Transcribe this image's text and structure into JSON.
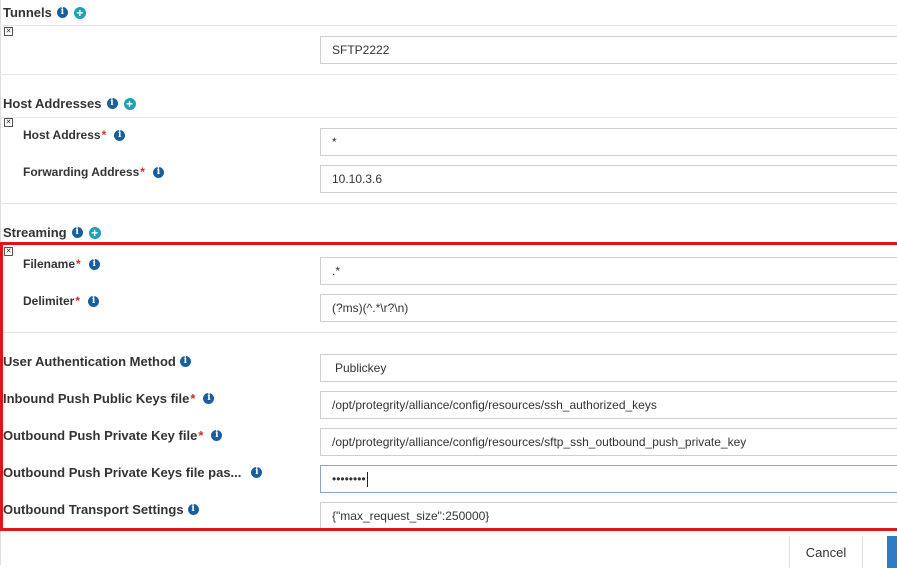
{
  "tunnels": {
    "title": "Tunnels",
    "info_icon": "i",
    "add_icon": "+",
    "remove_icon": "✕",
    "value": "SFTP2222"
  },
  "host_addresses": {
    "title": "Host Addresses",
    "info_icon": "i",
    "add_icon": "+",
    "remove_icon": "✕",
    "host_address": {
      "label": "Host Address",
      "required_mark": "*",
      "value": "*"
    },
    "forwarding_address": {
      "label": "Forwarding Address",
      "required_mark": "*",
      "value": "10.10.3.6"
    }
  },
  "streaming": {
    "title": "Streaming",
    "info_icon": "i",
    "add_icon": "+",
    "remove_icon": "✕",
    "filename": {
      "label": "Filename",
      "required_mark": "*",
      "value": ".*"
    },
    "delimiter": {
      "label": "Delimiter",
      "required_mark": "*",
      "value": "(?ms)(^.*\\r?\\n)"
    }
  },
  "settings": {
    "user_auth_method": {
      "label": "User Authentication Method",
      "value": "Publickey"
    },
    "inbound_push_public_keys_file": {
      "label": "Inbound Push Public Keys file",
      "required_mark": "*",
      "value": "/opt/protegrity/alliance/config/resources/ssh_authorized_keys"
    },
    "outbound_push_private_key_file": {
      "label": "Outbound Push Private Key file",
      "required_mark": "*",
      "value": "/opt/protegrity/alliance/config/resources/sftp_ssh_outbound_push_private_key"
    },
    "outbound_push_private_keys_file_passphrase": {
      "label": "Outbound Push Private Keys file pas...",
      "value": "••••••••"
    },
    "outbound_transport_settings": {
      "label": "Outbound Transport Settings",
      "value": "{\"max_request_size\":250000}"
    }
  },
  "footer": {
    "cancel_label": "Cancel"
  },
  "colors": {
    "highlight": "#e3131b",
    "info": "#1b5e9e",
    "add": "#1fa0b5",
    "primary": "#2f7cc5"
  }
}
